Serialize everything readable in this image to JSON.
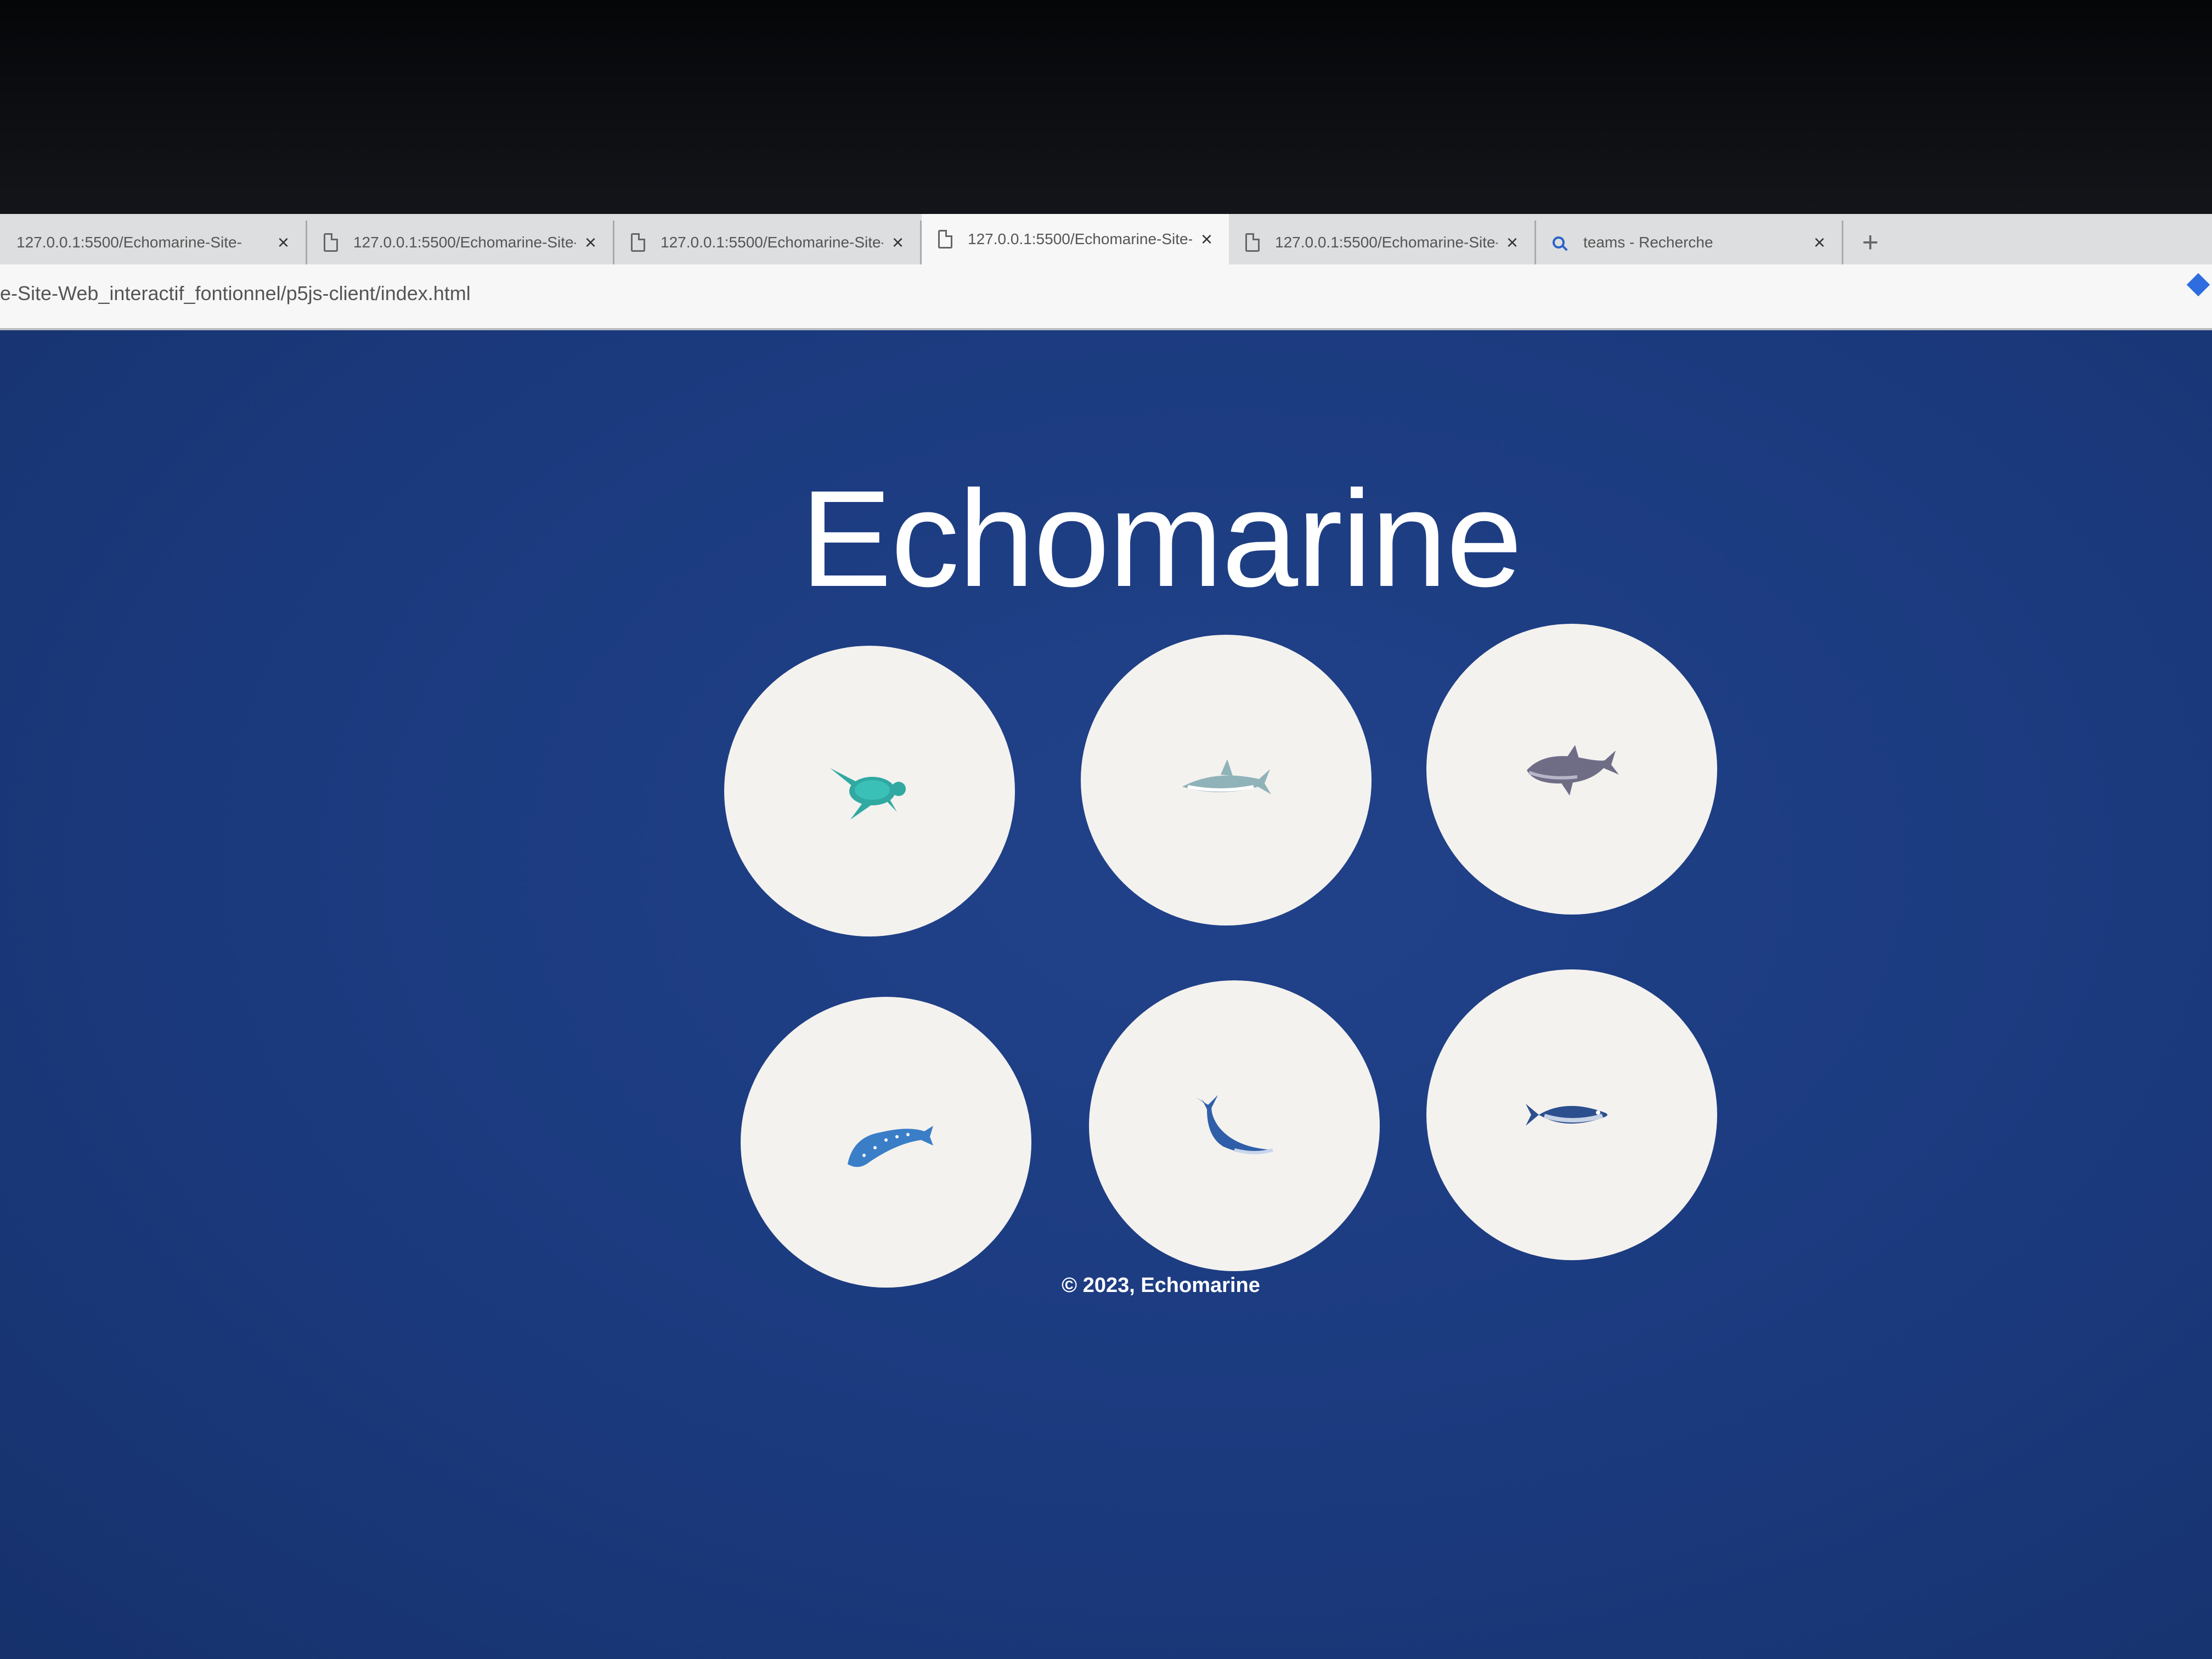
{
  "browser": {
    "tabs": [
      {
        "title": "127.0.0.1:5500/Echomarine-Site-",
        "icon": "page-icon",
        "active": false
      },
      {
        "title": "127.0.0.1:5500/Echomarine-Site-",
        "icon": "page-icon",
        "active": false
      },
      {
        "title": "127.0.0.1:5500/Echomarine-Site-",
        "icon": "page-icon",
        "active": false
      },
      {
        "title": "127.0.0.1:5500/Echomarine-Site-",
        "icon": "page-icon",
        "active": true
      },
      {
        "title": "127.0.0.1:5500/Echomarine-Site-",
        "icon": "page-icon",
        "active": false
      },
      {
        "title": "teams - Recherche",
        "icon": "search-icon",
        "active": false
      }
    ],
    "close_glyph": "×",
    "new_tab_glyph": "+",
    "url": "e-Site-Web_interactif_fontionnel/p5js-client/index.html"
  },
  "site": {
    "title": "Echomarine",
    "footer": "© 2023, Echomarine"
  },
  "animals": [
    {
      "name": "sea-turtle-icon",
      "color": "#2fa9a2"
    },
    {
      "name": "shark-icon",
      "color": "#8fb3b8"
    },
    {
      "name": "porpoise-icon",
      "color": "#6f6d86"
    },
    {
      "name": "whale-shark-icon",
      "color": "#3a7ec8"
    },
    {
      "name": "blue-whale-icon",
      "color": "#2f5fa8"
    },
    {
      "name": "tuna-icon",
      "color": "#2c4f8e"
    }
  ],
  "colors": {
    "background": "#1b3a7e",
    "card": "#f4f2ef",
    "text": "#ffffff"
  }
}
